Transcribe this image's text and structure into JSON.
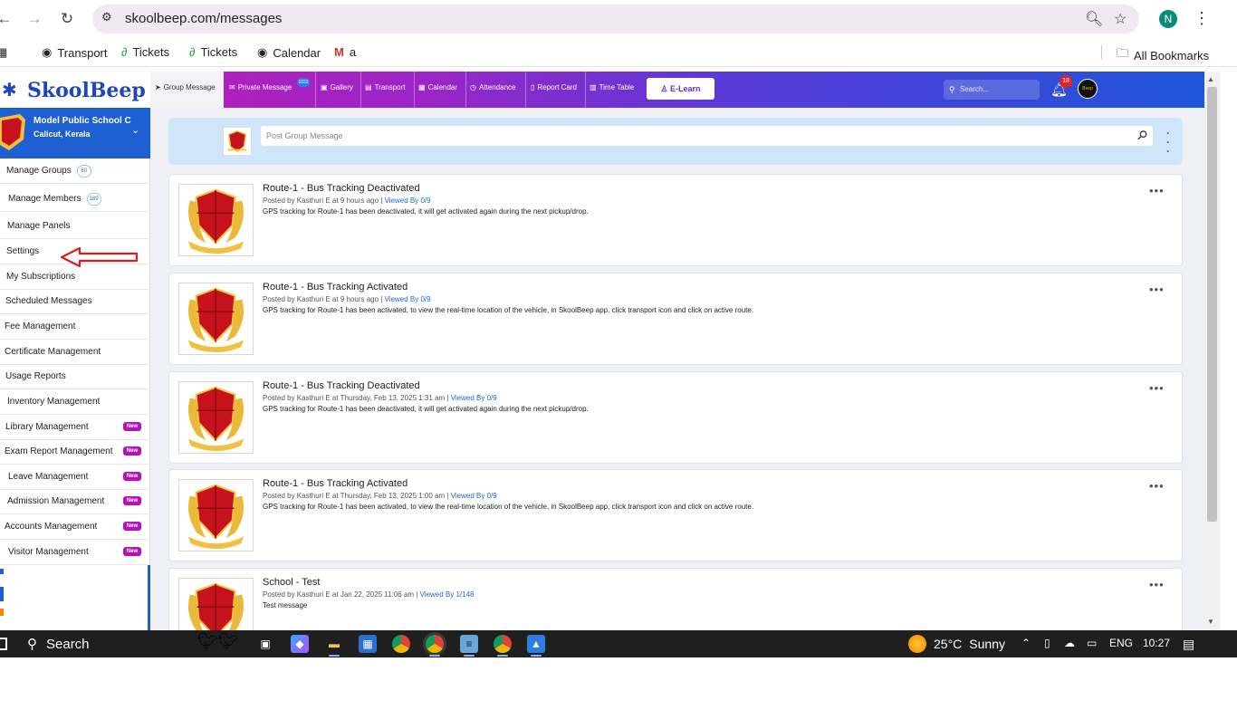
{
  "browser": {
    "url": "skoolbeep.com/messages",
    "profile_initial": "N",
    "bookmarks": [
      "Transport",
      "Tickets",
      "Tickets",
      "Calendar",
      "a"
    ],
    "all_bookmarks": "All Bookmarks"
  },
  "app": {
    "logo": "SkoolBeep",
    "tabs": [
      "Group Message",
      "Private Message",
      "Gallery",
      "Transport",
      "Calendar",
      "Attendance",
      "Report Card",
      "Time Table"
    ],
    "private_badge": "1022",
    "elearn": "E-Learn",
    "search_placeholder": "Search...",
    "notification_count": "18",
    "avatar_text": "Beep"
  },
  "school": {
    "name": "Model Public School C",
    "location": "Calicut, Kerala"
  },
  "sidebar": {
    "items": [
      {
        "label": "Manage Groups",
        "count": "60",
        "new": ""
      },
      {
        "label": "Manage Members",
        "count": "189",
        "new": ""
      },
      {
        "label": "Manage Panels",
        "count": "",
        "new": ""
      },
      {
        "label": "Settings",
        "count": "",
        "new": ""
      },
      {
        "label": "My Subscriptions",
        "count": "",
        "new": ""
      },
      {
        "label": "Scheduled Messages",
        "count": "",
        "new": ""
      },
      {
        "label": "Fee Management",
        "count": "",
        "new": ""
      },
      {
        "label": "Certificate Management",
        "count": "",
        "new": ""
      },
      {
        "label": "Usage Reports",
        "count": "",
        "new": ""
      },
      {
        "label": "Inventory Management",
        "count": "",
        "new": ""
      },
      {
        "label": "Library Management",
        "count": "",
        "new": "New"
      },
      {
        "label": "Exam Report Management",
        "count": "",
        "new": "New"
      },
      {
        "label": "Leave Management",
        "count": "",
        "new": "New"
      },
      {
        "label": "Admission Management",
        "count": "",
        "new": "New"
      },
      {
        "label": "Accounts Management",
        "count": "",
        "new": "New"
      },
      {
        "label": "Visitor Management",
        "count": "",
        "new": "New"
      }
    ]
  },
  "composer": {
    "placeholder": "Post Group Message"
  },
  "messages": [
    {
      "title": "Route-1 - Bus Tracking Deactivated",
      "posted": "Posted by Kasthuri E at 9 hours ago",
      "viewed": "Viewed By 0/9",
      "body": "GPS tracking for Route-1 has been deactivated, it will get activated again during the next pickup/drop."
    },
    {
      "title": "Route-1 - Bus Tracking Activated",
      "posted": "Posted by Kasthuri E at 9 hours ago",
      "viewed": "Viewed By 0/9",
      "body": "GPS tracking for Route-1 has been activated, to view the real-time location of the vehicle, in SkoolBeep app, click transport icon and click on active route."
    },
    {
      "title": "Route-1 - Bus Tracking Deactivated",
      "posted": "Posted by Kasthuri E at Thursday, Feb 13, 2025 1:31 am",
      "viewed": "Viewed By 0/9",
      "body": "GPS tracking for Route-1 has been deactivated, it will get activated again during the next pickup/drop."
    },
    {
      "title": "Route-1 - Bus Tracking Activated",
      "posted": "Posted by Kasthuri E at Thursday, Feb 13, 2025 1:00 am",
      "viewed": "Viewed By 0/9",
      "body": "GPS tracking for Route-1 has been activated, to view the real-time location of the vehicle, in SkoolBeep app, click transport icon and click on active route."
    },
    {
      "title": "School - Test",
      "posted": "Posted by Kasthuri E at Jan 22, 2025 11:06 am",
      "viewed": "Viewed By 1/148",
      "body": "Test message"
    }
  ],
  "taskbar": {
    "search": "Search",
    "temperature": "25°C",
    "weather": "Sunny",
    "language": "ENG",
    "time": "10:27"
  },
  "colors": {
    "brand_blue": "#1e5fd1",
    "header_magenta": "#c41cb5",
    "new_badge": "#b511b9",
    "viewed_link": "#1f6ad1"
  }
}
